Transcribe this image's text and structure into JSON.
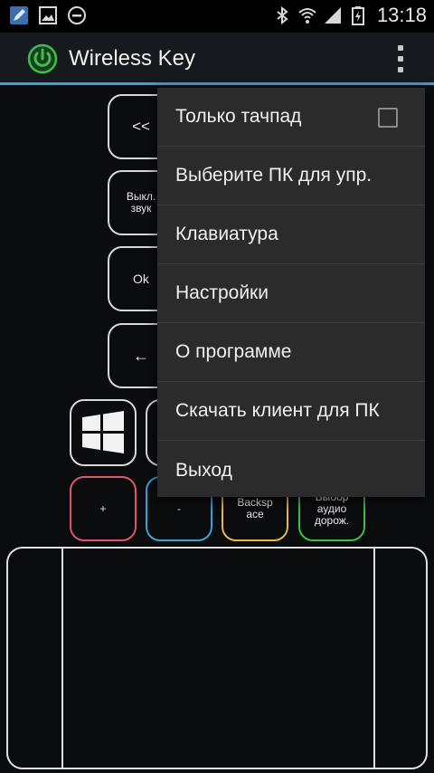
{
  "status_bar": {
    "time": "13:18",
    "icons": [
      "pencil-notification-icon",
      "image-notification-icon",
      "do-not-disturb-icon",
      "bluetooth-icon",
      "wifi-icon",
      "signal-icon",
      "battery-charging-icon"
    ]
  },
  "action_bar": {
    "title": "Wireless Key",
    "app_icon": "power-icon",
    "accent_color": "#3aa3d8",
    "icon_color": "#39c24a"
  },
  "keys": {
    "prev": "<<",
    "mute": "Выкл. звук",
    "ok": "Ok",
    "back_arrow": "←",
    "windows": "windows-logo-icon",
    "plus": "+",
    "minus": "-",
    "backspace": "Backsp ace",
    "audio_track": "Выбор аудио дорож."
  },
  "key_colors": {
    "plus": "#e0546a",
    "minus": "#3aa3d8",
    "backspace": "#e8b84a",
    "audio_track": "#39c24a"
  },
  "menu": {
    "items": [
      {
        "label": "Только тачпад",
        "checkbox": true,
        "checked": false
      },
      {
        "label": "Выберите ПК для упр."
      },
      {
        "label": "Клавиатура"
      },
      {
        "label": "Настройки"
      },
      {
        "label": "О программе"
      },
      {
        "label": "Скачать клиент для ПК"
      },
      {
        "label": "Выход"
      }
    ]
  }
}
